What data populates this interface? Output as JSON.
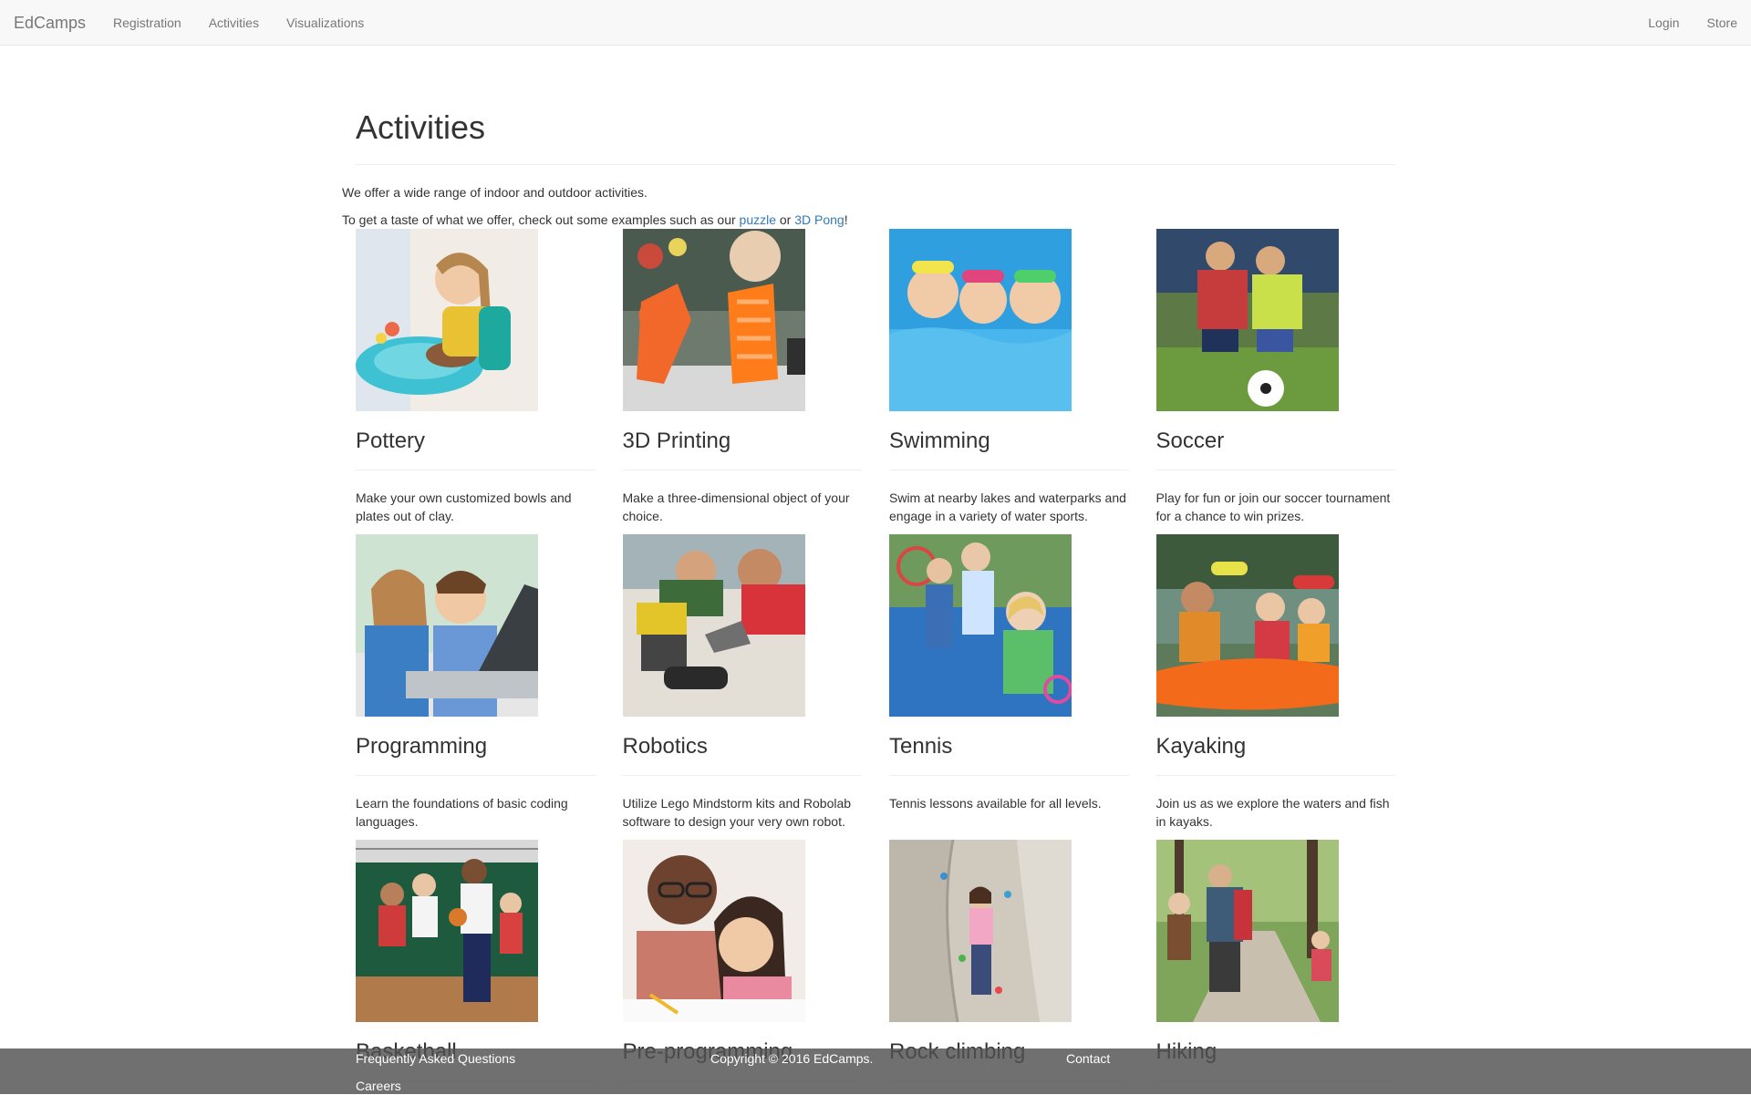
{
  "navbar": {
    "brand": "EdCamps",
    "left": [
      "Registration",
      "Activities",
      "Visualizations"
    ],
    "right": [
      "Login",
      "Store"
    ]
  },
  "page": {
    "title": "Activities",
    "intro_line1": "We offer a wide range of indoor and outdoor activities.",
    "intro_line2_prefix": "To get a taste of what we offer, check out some examples such as our ",
    "intro_link1": "puzzle",
    "intro_mid": " or ",
    "intro_link2": "3D Pong",
    "intro_suffix": "!"
  },
  "activities": [
    {
      "title": "Pottery",
      "desc": "Make your own customized bowls and plates out of clay.",
      "image": "pottery-photo"
    },
    {
      "title": "3D Printing",
      "desc": "Make a three-dimensional object of your choice.",
      "image": "3d-printing-photo"
    },
    {
      "title": "Swimming",
      "desc": "Swim at nearby lakes and waterparks and engage in a variety of water sports.",
      "image": "swimming-photo"
    },
    {
      "title": "Soccer",
      "desc": "Play for fun or join our soccer tournament for a chance to win prizes.",
      "image": "soccer-photo"
    },
    {
      "title": "Programming",
      "desc": "Learn the foundations of basic coding languages.",
      "image": "programming-photo"
    },
    {
      "title": "Robotics",
      "desc": "Utilize Lego Mindstorm kits and Robolab software to design your very own robot.",
      "image": "robotics-photo"
    },
    {
      "title": "Tennis",
      "desc": "Tennis lessons available for all levels.",
      "image": "tennis-photo"
    },
    {
      "title": "Kayaking",
      "desc": "Join us as we explore the waters and fish in kayaks.",
      "image": "kayaking-photo"
    },
    {
      "title": "Basketball",
      "desc": "",
      "image": "basketball-photo"
    },
    {
      "title": "Pre-programming",
      "desc": "",
      "image": "pre-programming-photo"
    },
    {
      "title": "Rock climbing",
      "desc": "",
      "image": "rock-climbing-photo"
    },
    {
      "title": "Hiking",
      "desc": "",
      "image": "hiking-photo"
    }
  ],
  "footer": {
    "faq": "Frequently Asked Questions",
    "careers": "Careers",
    "copyright": "Copyright © 2016 EdCamps.",
    "contact": "Contact"
  }
}
